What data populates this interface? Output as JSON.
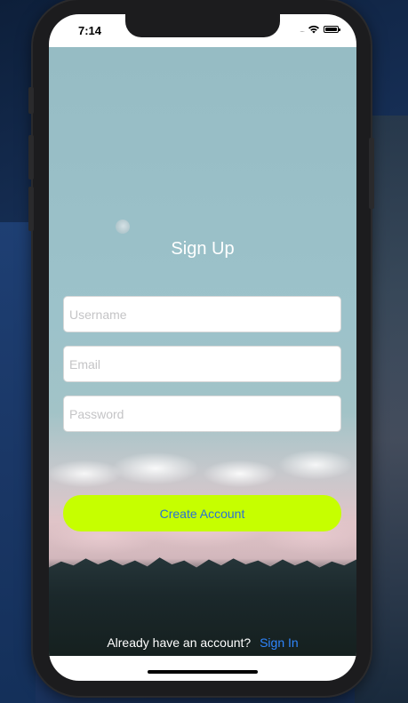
{
  "status_bar": {
    "time": "7:14",
    "signal": "....",
    "wifi_icon": "wifi-icon",
    "battery_icon": "battery-icon"
  },
  "signup": {
    "title": "Sign Up",
    "username_placeholder": "Username",
    "username_value": "",
    "email_placeholder": "Email",
    "email_value": "",
    "password_placeholder": "Password",
    "password_value": "",
    "create_button_label": "Create Account",
    "already_have_account_text": "Already have an account?",
    "sign_in_link_label": "Sign In"
  },
  "colors": {
    "button_background": "#c6ff00",
    "button_text": "#2a6fd6",
    "link": "#2f86ff",
    "title_text": "#ffffff"
  }
}
